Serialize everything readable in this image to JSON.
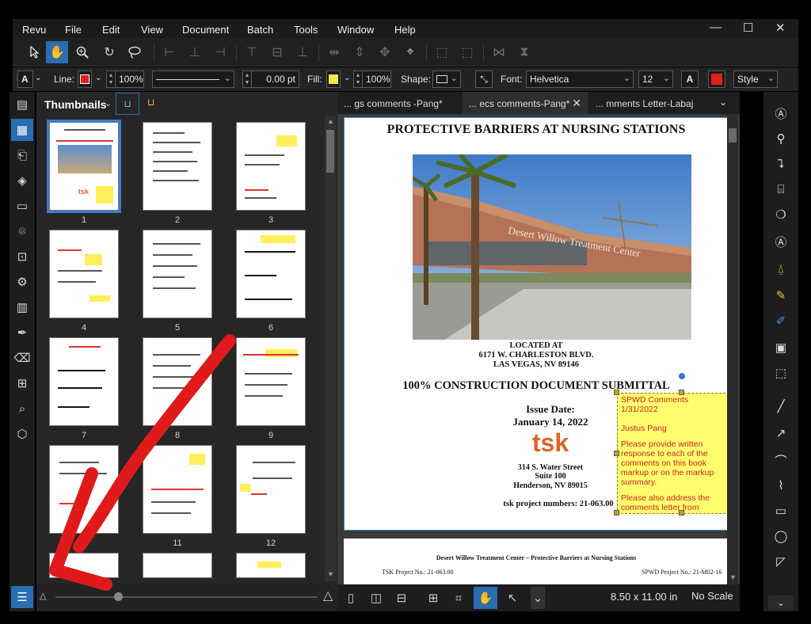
{
  "menu": [
    "Revu",
    "File",
    "Edit",
    "View",
    "Document",
    "Batch",
    "Tools",
    "Window",
    "Help"
  ],
  "window_controls": {
    "minimize": "—",
    "maximize": "☐",
    "close": "✕"
  },
  "properties": {
    "text_type": "A",
    "line_label": "Line:",
    "line_color": "#e02020",
    "line_opacity": "100%",
    "line_width": "0.00 pt",
    "fill_label": "Fill:",
    "fill_color": "#f5e74a",
    "fill_opacity": "100%",
    "shape_label": "Shape:",
    "font_label": "Font:",
    "font_value": "Helvetica",
    "font_size": "12",
    "font_color": "#e02020",
    "style_label": "Style"
  },
  "thumbnails": {
    "title": "Thumbnails",
    "pages": [
      "1",
      "2",
      "3",
      "4",
      "5",
      "6",
      "7",
      "8",
      "9",
      "10",
      "11",
      "12"
    ]
  },
  "tabs": [
    {
      "label": "... gs comments -Pang*",
      "active": false
    },
    {
      "label": "... ecs comments-Pang*",
      "active": true
    },
    {
      "label": "... mments Letter-Labaj",
      "active": false
    }
  ],
  "document": {
    "title_line": "PROTECTIVE BARRIERS AT NURSING STATIONS",
    "building_sign": "Desert Willow Treatment Center",
    "located_at": "LOCATED AT",
    "address1": "6171 W. CHARLESTON BLVD.",
    "address2": "LAS VEGAS, NV 89146",
    "submittal": "100% CONSTRUCTION DOCUMENT SUBMITTAL",
    "issue_label": "Issue Date:",
    "issue_date": "January 14, 2022",
    "logo": "tsk",
    "firm_addr1": "314 S. Water Street",
    "firm_addr2": "Suite 100",
    "firm_addr3": "Henderson, NV 89015",
    "project_numbers": "tsk project numbers: 21-063.00",
    "page2_header": "Desert Willow Treatment Center – Protective Barriers at Nursing Stations",
    "page2_left": "TSK Project No.: 21-063.00",
    "page2_right": "SPWD Project No.: 21-M02-16"
  },
  "comment": {
    "author": "SPWD Comments",
    "date": "1/31/2022",
    "name": "Justus Pang",
    "para1": "Please provide written response to each of the comments on this book markup or on the markup summary.",
    "para2": "Please also address the comments letter from"
  },
  "status": {
    "page_size": "8.50 x 11.00 in",
    "scale": "No Scale"
  },
  "colors": {
    "accent": "#2a6db0",
    "annotation_red": "#e02020",
    "comment_yellow": "#ffff6e"
  }
}
